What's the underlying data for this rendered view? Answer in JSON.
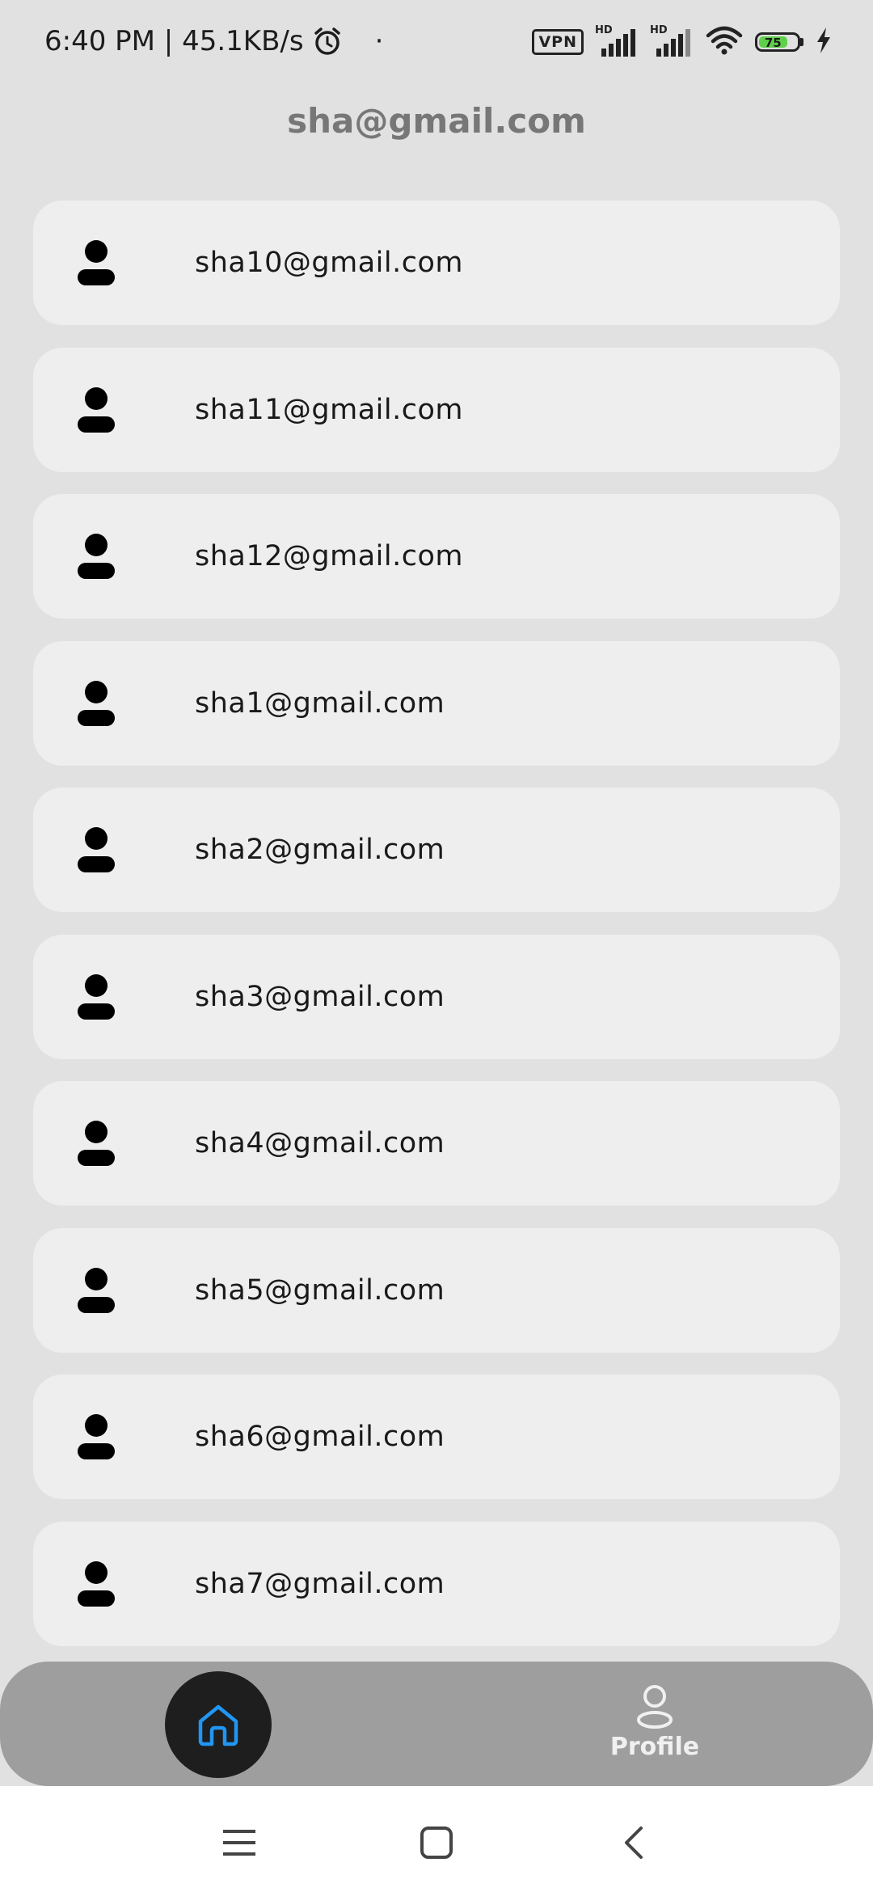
{
  "status_bar": {
    "time_speed": "6:40 PM | 45.1KB/s",
    "dot": "·",
    "vpn": "VPN",
    "hd1": "HD",
    "hd2": "HD",
    "battery_level": "75",
    "battery_color": "#5fd04a"
  },
  "header": {
    "title": "sha@gmail.com"
  },
  "users": [
    {
      "email": "sha10@gmail.com"
    },
    {
      "email": "sha11@gmail.com"
    },
    {
      "email": "sha12@gmail.com"
    },
    {
      "email": "sha1@gmail.com"
    },
    {
      "email": "sha2@gmail.com"
    },
    {
      "email": "sha3@gmail.com"
    },
    {
      "email": "sha4@gmail.com"
    },
    {
      "email": "sha5@gmail.com"
    },
    {
      "email": "sha6@gmail.com"
    },
    {
      "email": "sha7@gmail.com"
    }
  ],
  "bottom_nav": {
    "home_icon": "home-icon",
    "profile_label": "Profile",
    "home_accent": "#2196f3"
  }
}
